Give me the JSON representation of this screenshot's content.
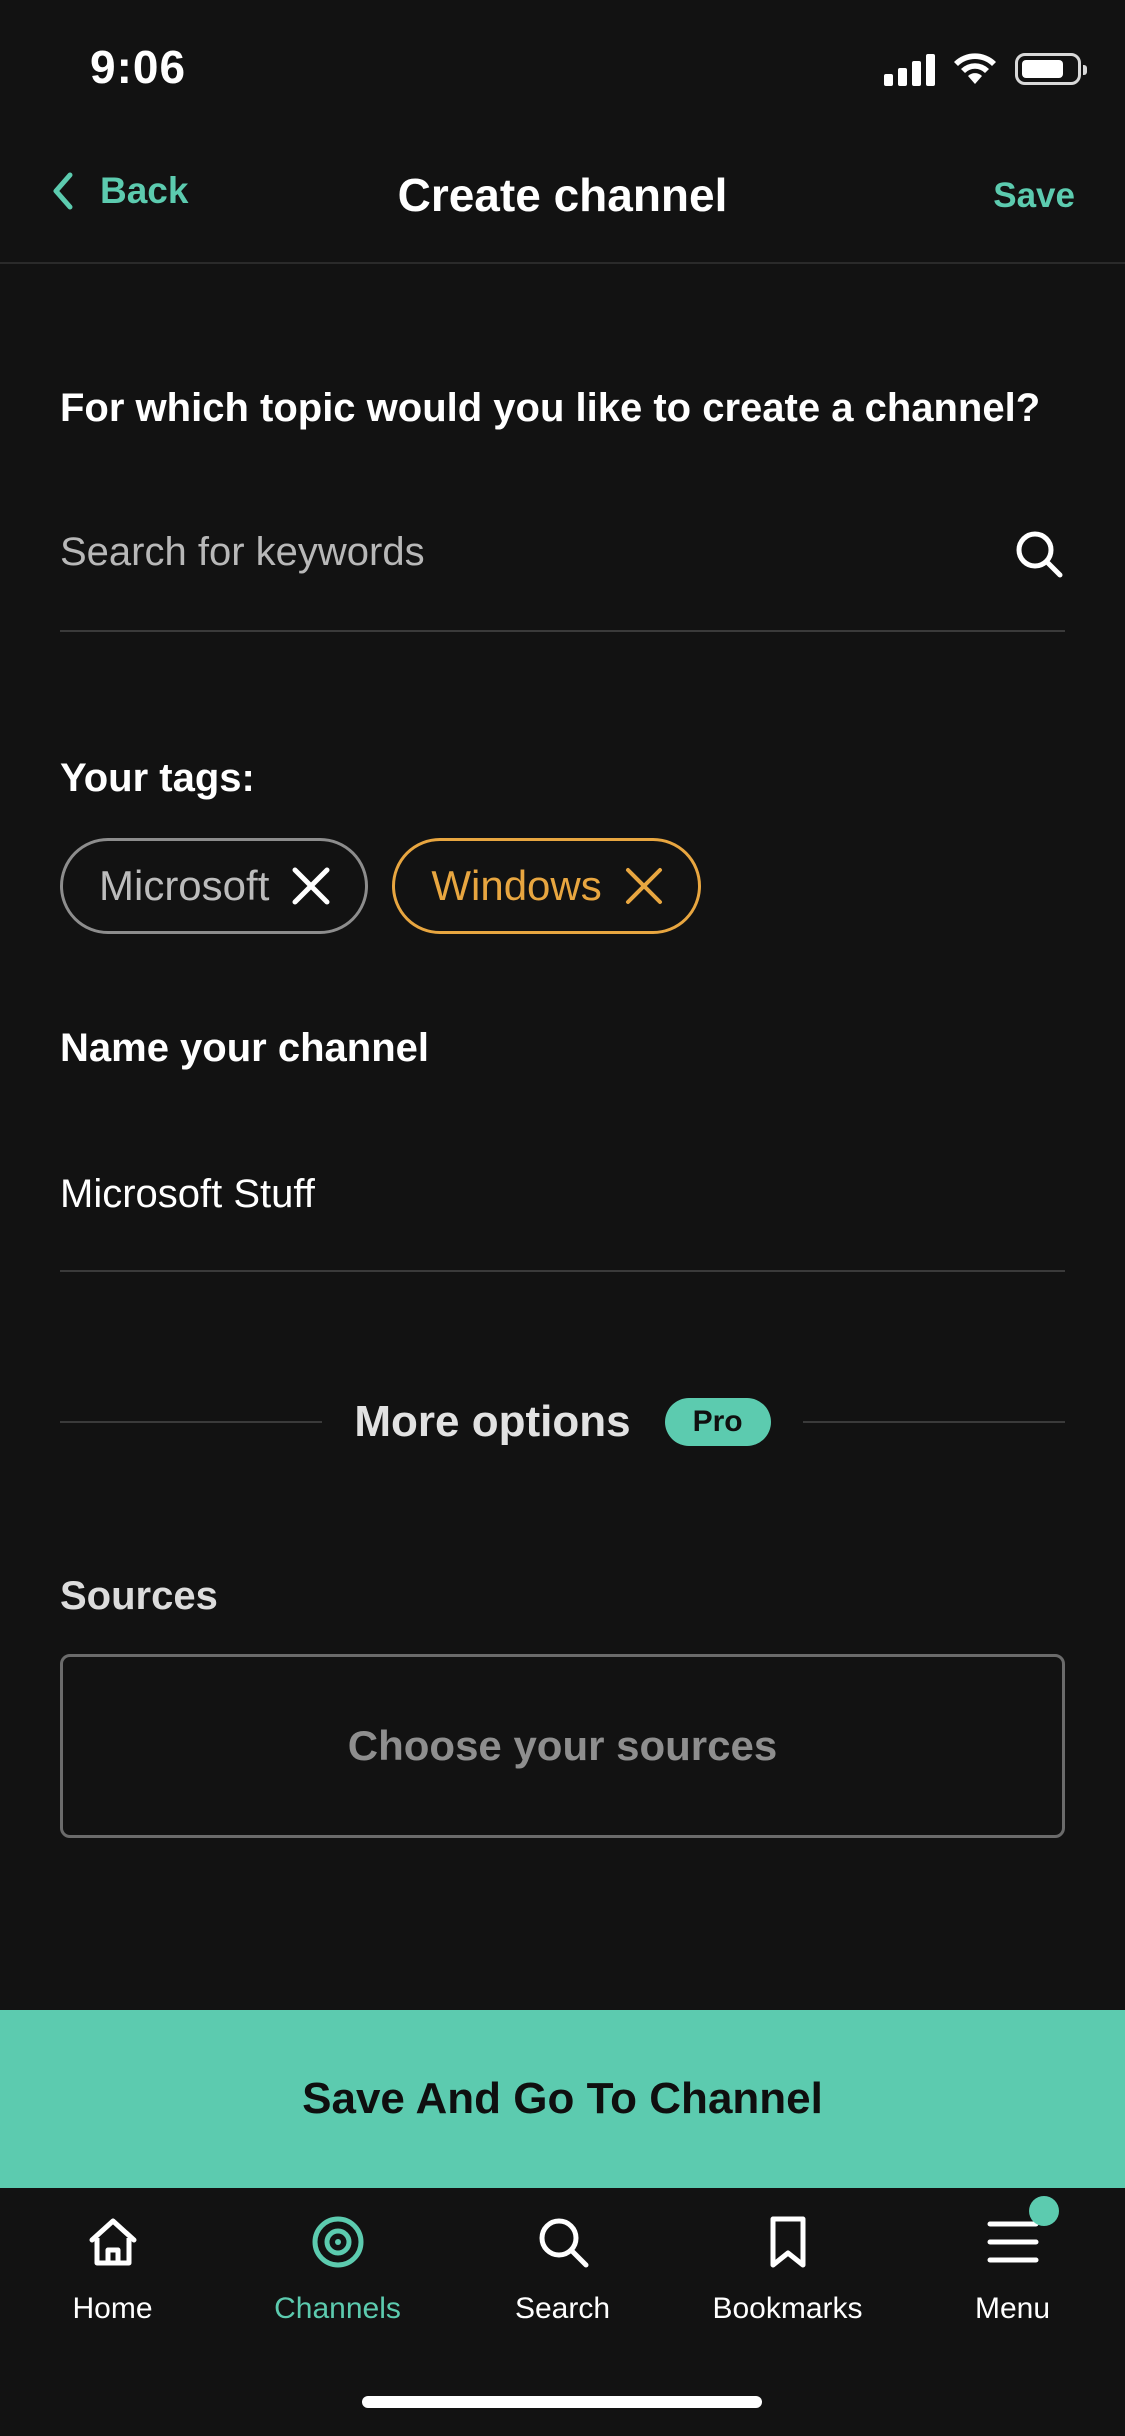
{
  "status_bar": {
    "time": "9:06"
  },
  "nav": {
    "back_label": "Back",
    "title": "Create channel",
    "save_label": "Save"
  },
  "topic": {
    "question": "For which topic would you like to create a channel?",
    "search_placeholder": "Search for keywords",
    "search_value": ""
  },
  "tags": {
    "label": "Your tags:",
    "items": [
      {
        "label": "Microsoft",
        "color": "#bcbcbc"
      },
      {
        "label": "Windows",
        "color": "#e8a640"
      }
    ]
  },
  "channel_name": {
    "label": "Name your channel",
    "value": "Microsoft Stuff"
  },
  "more_options": {
    "label": "More options",
    "badge": "Pro"
  },
  "sources": {
    "label": "Sources",
    "placeholder": "Choose your sources"
  },
  "cta": {
    "label": "Save And Go To Channel"
  },
  "tab_bar": {
    "items": [
      {
        "label": "Home",
        "icon": "home-icon",
        "active": false
      },
      {
        "label": "Channels",
        "icon": "channels-icon",
        "active": true
      },
      {
        "label": "Search",
        "icon": "search-icon",
        "active": false
      },
      {
        "label": "Bookmarks",
        "icon": "bookmark-icon",
        "active": false
      },
      {
        "label": "Menu",
        "icon": "menu-icon",
        "active": false,
        "notification_dot": true
      }
    ]
  },
  "colors": {
    "accent": "#5ccbaf",
    "background": "#121212",
    "tag_highlight": "#e8a640"
  }
}
